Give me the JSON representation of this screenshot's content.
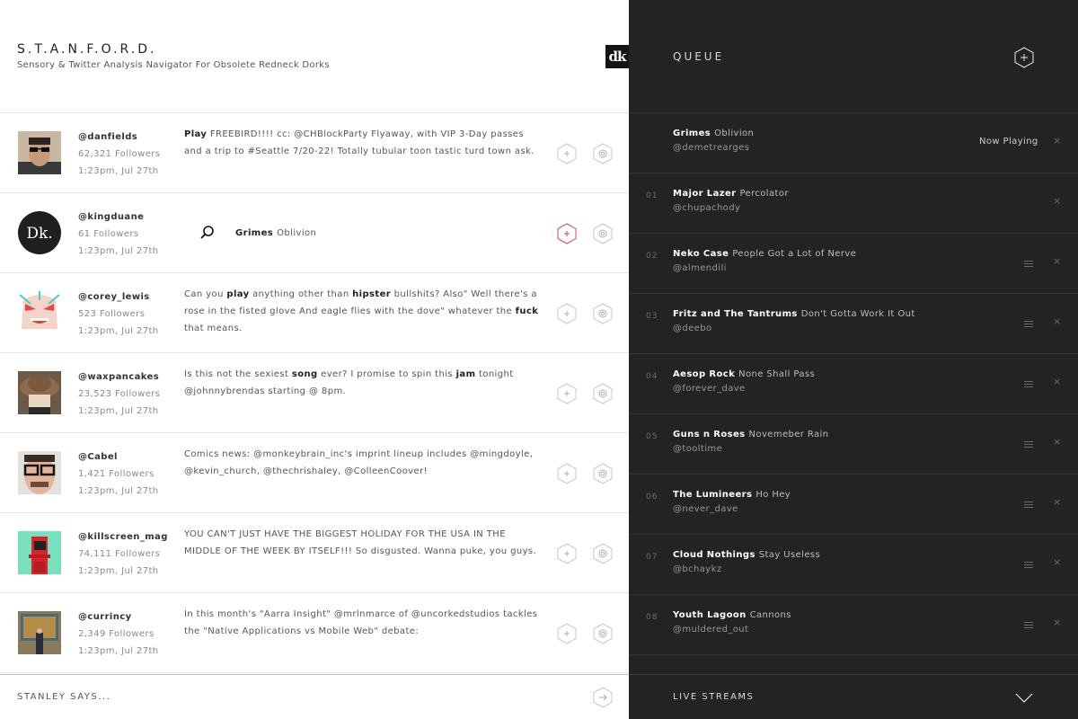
{
  "header": {
    "title": "S.T.A.N.F.O.R.D.",
    "subtitle": "Sensory & Twitter Analysis Navigator For Obsolete Redneck Dorks",
    "logo_text": "dk"
  },
  "colors": {
    "accent_red": "#e0424e",
    "dark_bg": "#252222",
    "divider": "#e6e6e6"
  },
  "feed": [
    {
      "handle": "@danfields",
      "followers": "62,321 Followers",
      "time": "1:23pm, Jul 27th",
      "avatar": "photo-man-sunglasses",
      "message": [
        {
          "t": "Play",
          "b": true
        },
        {
          "t": " FREEBIRD!!!! cc: @CHBlockParty Flyaway, with VIP 3-Day passes and a trip to #Seattle 7/20-22! Totally tubular toon tastic turd town ask.",
          "b": false
        }
      ]
    },
    {
      "handle": "@kingduane",
      "followers": "61 Followers",
      "time": "1:23pm, Jul 27th",
      "avatar": "dk-logo-avatar",
      "avatar_text": "Dk.",
      "song_result": {
        "artist": "Grimes",
        "song": "Oblivion"
      },
      "highlighted": true
    },
    {
      "handle": "@corey_lewis",
      "followers": "523 Followers",
      "time": "1:23pm, Jul 27th",
      "avatar": "cartoon-face",
      "message": [
        {
          "t": "Can you ",
          "b": false
        },
        {
          "t": "play",
          "b": true
        },
        {
          "t": " anything other than ",
          "b": false
        },
        {
          "t": "hipster",
          "b": true
        },
        {
          "t": " bullshits? Also\" Well there's a rose in the fisted glove And eagle flies with the dove\" whatever the ",
          "b": false
        },
        {
          "t": "fuck",
          "b": true
        },
        {
          "t": " that means.",
          "b": false
        }
      ]
    },
    {
      "handle": "@waxpancakes",
      "followers": "23,523 Followers",
      "time": "1:23pm, Jul 27th",
      "avatar": "photo-hat",
      "message": [
        {
          "t": "Is this not the sexiest ",
          "b": false
        },
        {
          "t": "song",
          "b": true
        },
        {
          "t": " ever? I promise to spin this ",
          "b": false
        },
        {
          "t": "jam",
          "b": true
        },
        {
          "t": " tonight @johnnybrendas starting @ 8pm.",
          "b": false
        }
      ]
    },
    {
      "handle": "@Cabel",
      "followers": "1,421 Followers",
      "time": "1:23pm, Jul 27th",
      "avatar": "photo-man-glasses",
      "message": [
        {
          "t": "Comics news: @monkeybrain_inc's imprint lineup includes @mingdoyle, @kevin_church, @thechrishaley, @ColleenCoover!",
          "b": false
        }
      ]
    },
    {
      "handle": "@killscreen_mag",
      "followers": "74,111 Followers",
      "time": "1:23pm, Jul 27th",
      "avatar": "arcade-cabinet",
      "message": [
        {
          "t": "YOU CAN'T JUST HAVE THE BIGGEST HOLIDAY FOR THE USA IN THE MIDDLE OF THE WEEK BY ITSELF!!! So disgusted. Wanna puke, you guys.",
          "b": false
        }
      ]
    },
    {
      "handle": "@currincy",
      "followers": "2,349 Followers",
      "time": "1:23pm, Jul 27th",
      "avatar": "painting-gallery",
      "message": [
        {
          "t": "In this month's \"Aarra Insight\" @mrlnmarce of @uncorkedstudios tackles the \"Native Applications vs Mobile Web\" debate:",
          "b": false
        }
      ]
    }
  ],
  "stanley": {
    "label": "STANLEY SAYS..."
  },
  "queue": {
    "title": "QUEUE",
    "now_playing": {
      "artist": "Grimes",
      "song": "Oblivion",
      "user": "@demetrearges",
      "status": "Now Playing"
    },
    "items": [
      {
        "num": "01",
        "artist": "Major Lazer",
        "song": "Percolator",
        "user": "@chupachody",
        "draggable": false
      },
      {
        "num": "02",
        "artist": "Neko Case",
        "song": "People Got a Lot of Nerve",
        "user": "@almendili",
        "draggable": true
      },
      {
        "num": "03",
        "artist": "Fritz and The Tantrums",
        "song": "Don't Gotta Work It Out",
        "user": "@deebo",
        "draggable": true
      },
      {
        "num": "04",
        "artist": "Aesop Rock",
        "song": "None Shall Pass",
        "user": "@forever_dave",
        "draggable": true
      },
      {
        "num": "05",
        "artist": "Guns n Roses",
        "song": "Novemeber Rain",
        "user": "@tooltime",
        "draggable": true
      },
      {
        "num": "06",
        "artist": "The Lumineers",
        "song": "Ho Hey",
        "user": "@never_dave",
        "draggable": true
      },
      {
        "num": "07",
        "artist": "Cloud Nothings",
        "song": "Stay Useless",
        "user": "@bchaykz",
        "draggable": true
      },
      {
        "num": "08",
        "artist": "Youth Lagoon",
        "song": "Cannons",
        "user": "@muldered_out",
        "draggable": true
      }
    ],
    "remove_glyph": "×"
  },
  "live_streams": {
    "label": "LIVE STREAMS"
  }
}
